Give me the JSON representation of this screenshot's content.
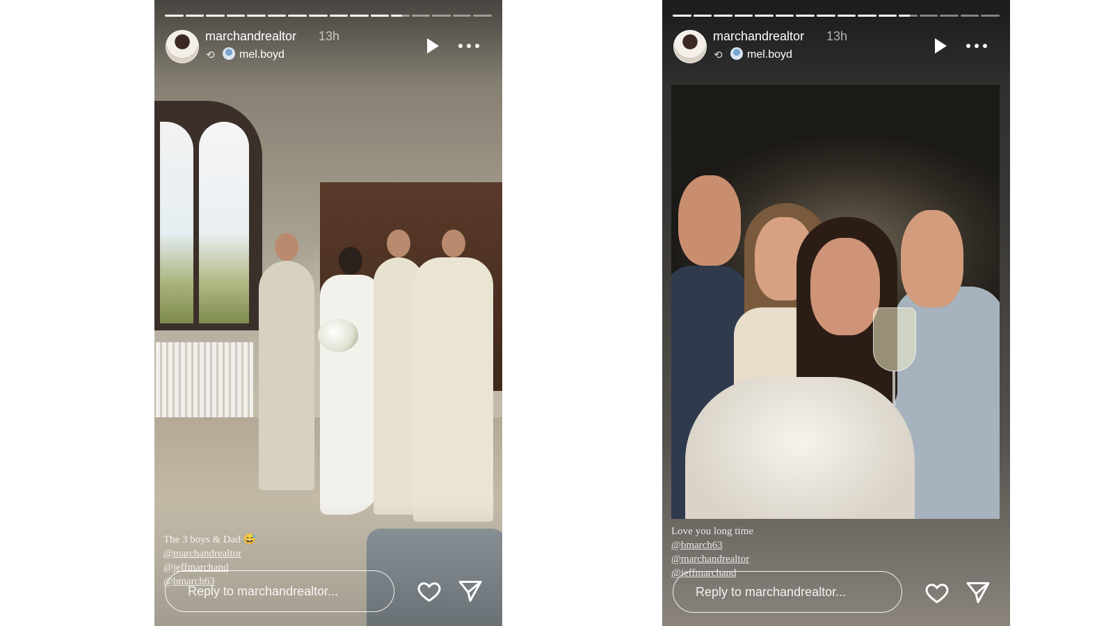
{
  "stories": [
    {
      "username": "marchandrealtor",
      "time": "13h",
      "repost_user": "mel.boyd",
      "caption": {
        "line1": "The 3 boys & Dad 😅",
        "tags": [
          "@marchandrealtor",
          "@jeffmarchand",
          "@bmarch63"
        ]
      },
      "reply_placeholder": "Reply to marchandrealtor...",
      "progress": {
        "total_segments": 16,
        "completed_segments": 11,
        "current_fraction": 0.6
      }
    },
    {
      "username": "marchandrealtor",
      "time": "13h",
      "repost_user": "mel.boyd",
      "caption": {
        "line1": "Love you long time",
        "tags": [
          "@bmarch63",
          "@marchandrealtor",
          "@jeffmarchand"
        ]
      },
      "reply_placeholder": "Reply to marchandrealtor...",
      "progress": {
        "total_segments": 16,
        "completed_segments": 11,
        "current_fraction": 0.6
      }
    }
  ],
  "icons": {
    "play": "play-icon",
    "more": "more-icon",
    "repost": "repost-icon",
    "like": "heart-icon",
    "share": "send-icon"
  }
}
